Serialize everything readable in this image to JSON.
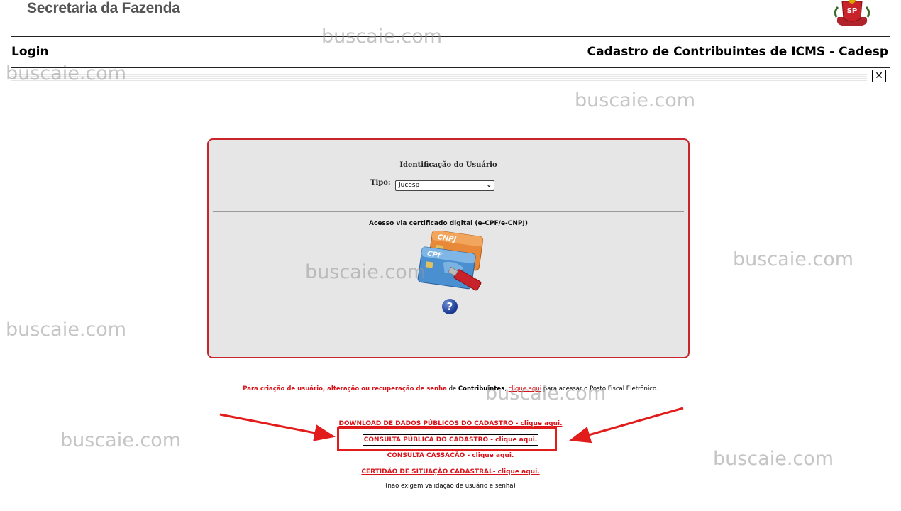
{
  "header": {
    "brand": "Secretaria da Fazenda",
    "emblem_text": "SP",
    "login": "Login",
    "system_title": "Cadastro de Contribuintes de ICMS - Cadesp",
    "close_symbol": "✕"
  },
  "panel": {
    "title": "Identificação do Usuário",
    "tipo_label": "Tipo:",
    "tipo_value": "Jucesp",
    "certificate_title": "Acesso via certificado digital (e-CPF/e-CNPJ)",
    "card_cnpj": "CNPJ",
    "card_cpf": "CPF",
    "help_symbol": "?"
  },
  "info": {
    "red_text": "Para criação de usuário, alteração ou recuperação de senha",
    "mid_text": " de ",
    "bold_text": "Contribuintes",
    "comma": ",",
    "link_text": "clique aqui",
    "tail_text": " para acessar o Posto Fiscal Eletrônico."
  },
  "links": {
    "download": "DOWNLOAD DE DADOS PÚBLICOS DO CADASTRO - clique aqui.",
    "consulta_publica": "CONSULTA PÚBLICA DO CADASTRO - clique aqui.",
    "consulta_cassacao": "CONSULTA CASSAÇÃO - clique aqui.",
    "certidao": "CERTIDÃO DE SITUAÇÃO CADASTRAL- clique aqui."
  },
  "footnote": "(não exigem validação de usuário e senha)",
  "watermark": "buscaie.com",
  "colors": {
    "panel_border": "#c9262b",
    "link_red": "#d8141a",
    "annotation_red": "#e21b1b",
    "panel_bg": "#e6e6e6"
  }
}
